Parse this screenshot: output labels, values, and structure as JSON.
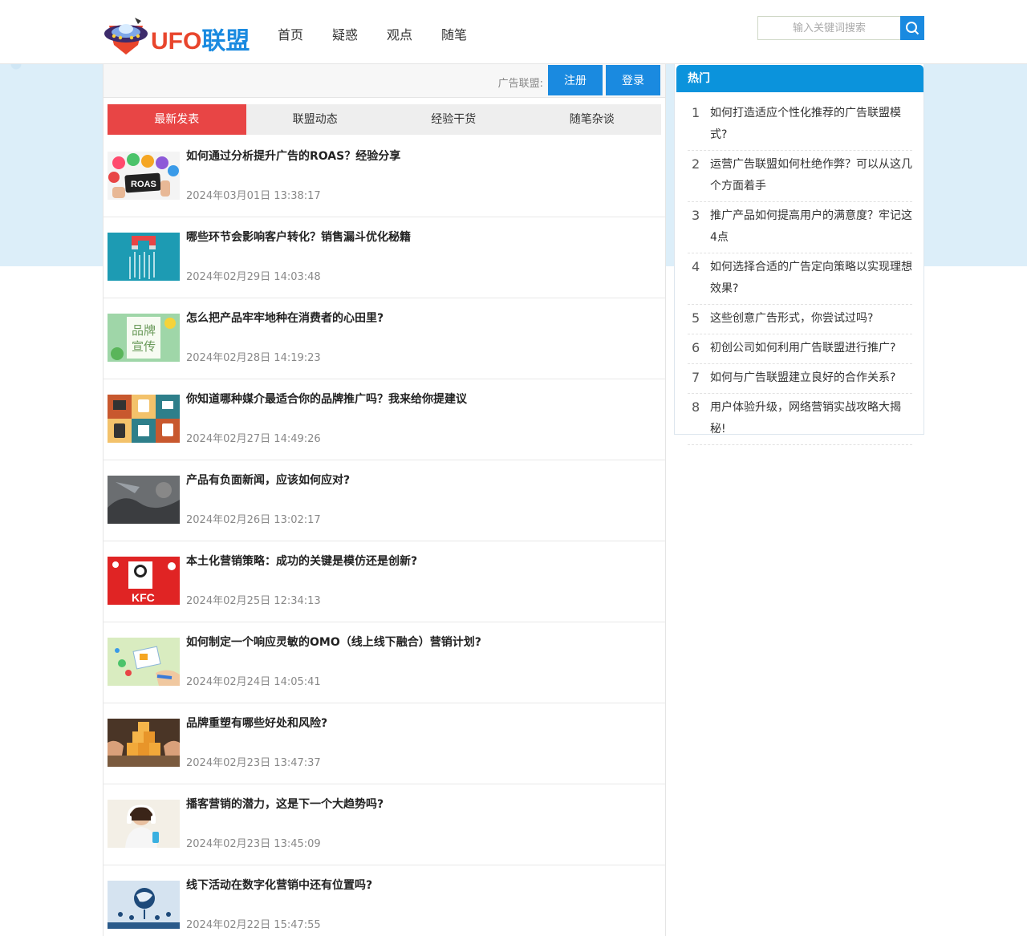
{
  "brand": {
    "ufo": "UFO",
    "lianmeng": "联盟"
  },
  "nav": [
    {
      "label": "首页"
    },
    {
      "label": "疑惑"
    },
    {
      "label": "观点"
    },
    {
      "label": "随笔"
    }
  ],
  "search": {
    "placeholder": "输入关键词搜索",
    "icon": "search-icon"
  },
  "topbar": {
    "ad_label": "广告联盟:",
    "register": "注册",
    "login": "登录"
  },
  "tabs": [
    {
      "label": "最新发表",
      "active": true
    },
    {
      "label": "联盟动态",
      "active": false
    },
    {
      "label": "经验干货",
      "active": false
    },
    {
      "label": "随笔杂谈",
      "active": false
    }
  ],
  "articles": [
    {
      "title": "如何通过分析提升广告的ROAS？经验分享",
      "date": "2024年03月01日 13:38:17",
      "thumb_text": "ROAS"
    },
    {
      "title": "哪些环节会影响客户转化？销售漏斗优化秘籍",
      "date": "2024年02月29日 14:03:48"
    },
    {
      "title": "怎么把产品牢牢地种在消费者的心田里?",
      "date": "2024年02月28日 14:19:23",
      "thumb_text": "品牌宣传"
    },
    {
      "title": "你知道哪种媒介最适合你的品牌推广吗？我来给你提建议",
      "date": "2024年02月27日 14:49:26"
    },
    {
      "title": "产品有负面新闻，应该如何应对?",
      "date": "2024年02月26日 13:02:17"
    },
    {
      "title": "本土化营销策略：成功的关键是模仿还是创新?",
      "date": "2024年02月25日 12:34:13",
      "thumb_text": "KFC"
    },
    {
      "title": "如何制定一个响应灵敏的OMO（线上线下融合）营销计划?",
      "date": "2024年02月24日 14:05:41"
    },
    {
      "title": "品牌重塑有哪些好处和风险?",
      "date": "2024年02月23日 13:47:37"
    },
    {
      "title": "播客营销的潜力，这是下一个大趋势吗?",
      "date": "2024年02月23日 13:45:09"
    },
    {
      "title": "线下活动在数字化营销中还有位置吗?",
      "date": "2024年02月22日 15:47:55"
    }
  ],
  "sidebar": {
    "title": "热门",
    "items": [
      {
        "num": "1",
        "text": "如何打造适应个性化推荐的广告联盟模式?"
      },
      {
        "num": "2",
        "text": "运营广告联盟如何杜绝作弊？可以从这几个方面着手"
      },
      {
        "num": "3",
        "text": "推广产品如何提高用户的满意度？牢记这4点"
      },
      {
        "num": "4",
        "text": "如何选择合适的广告定向策略以实现理想效果?"
      },
      {
        "num": "5",
        "text": "这些创意广告形式，你尝试过吗?"
      },
      {
        "num": "6",
        "text": "初创公司如何利用广告联盟进行推广?"
      },
      {
        "num": "7",
        "text": "如何与广告联盟建立良好的合作关系?"
      },
      {
        "num": "8",
        "text": "用户体验升级，网络营销实战攻略大揭秘!"
      }
    ]
  },
  "colors": {
    "accent": "#1a8ae0",
    "tab_active": "#e84545",
    "sky": "#dceef9"
  }
}
